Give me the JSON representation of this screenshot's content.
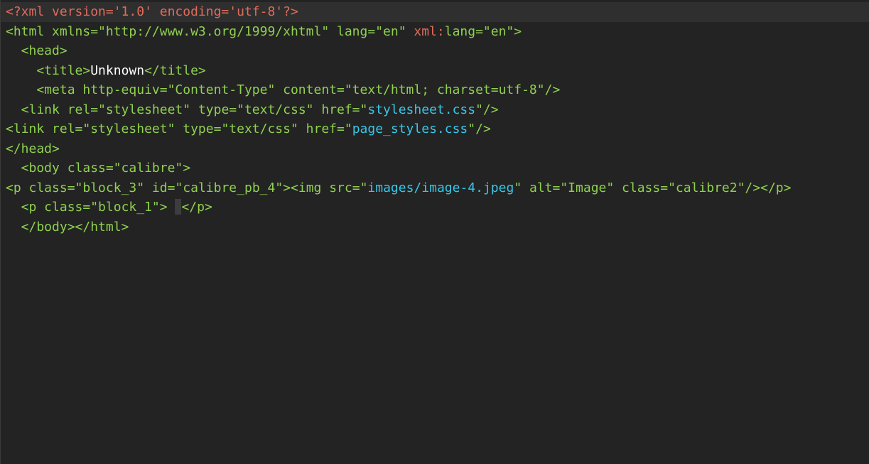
{
  "colors": {
    "background": "#232323",
    "current_line": "#2f2f2f",
    "declaration": "#e06c5c",
    "tag": "#8fd14f",
    "attribute": "#8fd14f",
    "namespace": "#e06c5c",
    "string": "#8fd14f",
    "link": "#38c7e8",
    "text": "#ffffff",
    "plain": "#e6e6e6"
  },
  "editor": {
    "lines": [
      {
        "current": true,
        "tokens": [
          {
            "t": "<?xml version='1.0' encoding='utf-8'?>",
            "c": "declaration"
          }
        ]
      },
      {
        "tokens": [
          {
            "t": "<html xmlns=",
            "c": "tag"
          },
          {
            "t": "\"http://www.w3.org/1999/xhtml\"",
            "c": "string"
          },
          {
            "t": " lang=",
            "c": "attribute"
          },
          {
            "t": "\"en\"",
            "c": "string"
          },
          {
            "t": " xml:",
            "c": "namespace"
          },
          {
            "t": "lang=",
            "c": "attribute"
          },
          {
            "t": "\"en\">",
            "c": "string"
          }
        ]
      },
      {
        "tokens": [
          {
            "t": "  <head>",
            "c": "tag"
          }
        ]
      },
      {
        "tokens": [
          {
            "t": "    <title>",
            "c": "tag"
          },
          {
            "t": "Unknown",
            "c": "text"
          },
          {
            "t": "</title>",
            "c": "tag"
          }
        ]
      },
      {
        "tokens": [
          {
            "t": "    <meta http-equiv=",
            "c": "tag"
          },
          {
            "t": "\"Content-Type\"",
            "c": "string"
          },
          {
            "t": " content=",
            "c": "attribute"
          },
          {
            "t": "\"text/html; charset=utf-8\"/>",
            "c": "string"
          }
        ]
      },
      {
        "tokens": [
          {
            "t": "  <link rel=",
            "c": "tag"
          },
          {
            "t": "\"stylesheet\"",
            "c": "string"
          },
          {
            "t": " type=",
            "c": "attribute"
          },
          {
            "t": "\"text/css\"",
            "c": "string"
          },
          {
            "t": " href=",
            "c": "attribute"
          },
          {
            "t": "\"",
            "c": "string"
          },
          {
            "t": "stylesheet.css",
            "c": "link"
          },
          {
            "t": "\"/>",
            "c": "string"
          }
        ]
      },
      {
        "tokens": [
          {
            "t": "<link rel=",
            "c": "tag"
          },
          {
            "t": "\"stylesheet\"",
            "c": "string"
          },
          {
            "t": " type=",
            "c": "attribute"
          },
          {
            "t": "\"text/css\"",
            "c": "string"
          },
          {
            "t": " href=",
            "c": "attribute"
          },
          {
            "t": "\"",
            "c": "string"
          },
          {
            "t": "page_styles.css",
            "c": "link"
          },
          {
            "t": "\"/>",
            "c": "string"
          }
        ]
      },
      {
        "tokens": [
          {
            "t": "</head>",
            "c": "tag"
          }
        ]
      },
      {
        "tokens": [
          {
            "t": "  <body class=",
            "c": "tag"
          },
          {
            "t": "\"calibre\">",
            "c": "string"
          }
        ]
      },
      {
        "tokens": [
          {
            "t": "<p class=",
            "c": "tag"
          },
          {
            "t": "\"block_3\"",
            "c": "string"
          },
          {
            "t": " id=",
            "c": "attribute"
          },
          {
            "t": "\"calibre_pb_4\">",
            "c": "string"
          },
          {
            "t": "<img src=",
            "c": "tag"
          },
          {
            "t": "\"",
            "c": "string"
          },
          {
            "t": "images/image-4.jpeg",
            "c": "link"
          },
          {
            "t": "\"",
            "c": "string"
          },
          {
            "t": " alt=",
            "c": "attribute"
          },
          {
            "t": "\"Image\"",
            "c": "string"
          },
          {
            "t": " class=",
            "c": "attribute"
          },
          {
            "t": "\"calibre2\"/></p>",
            "c": "string"
          }
        ]
      },
      {
        "cursor": true,
        "tokens": [
          {
            "t": "  <p class=",
            "c": "tag"
          },
          {
            "t": "\"block_1\">",
            "c": "string"
          },
          {
            "t": " ",
            "c": "plain"
          },
          {
            "t": "",
            "c": "cursor"
          },
          {
            "t": "</p>",
            "c": "tag"
          }
        ]
      },
      {
        "tokens": [
          {
            "t": "  </body></html>",
            "c": "tag"
          }
        ]
      }
    ]
  }
}
